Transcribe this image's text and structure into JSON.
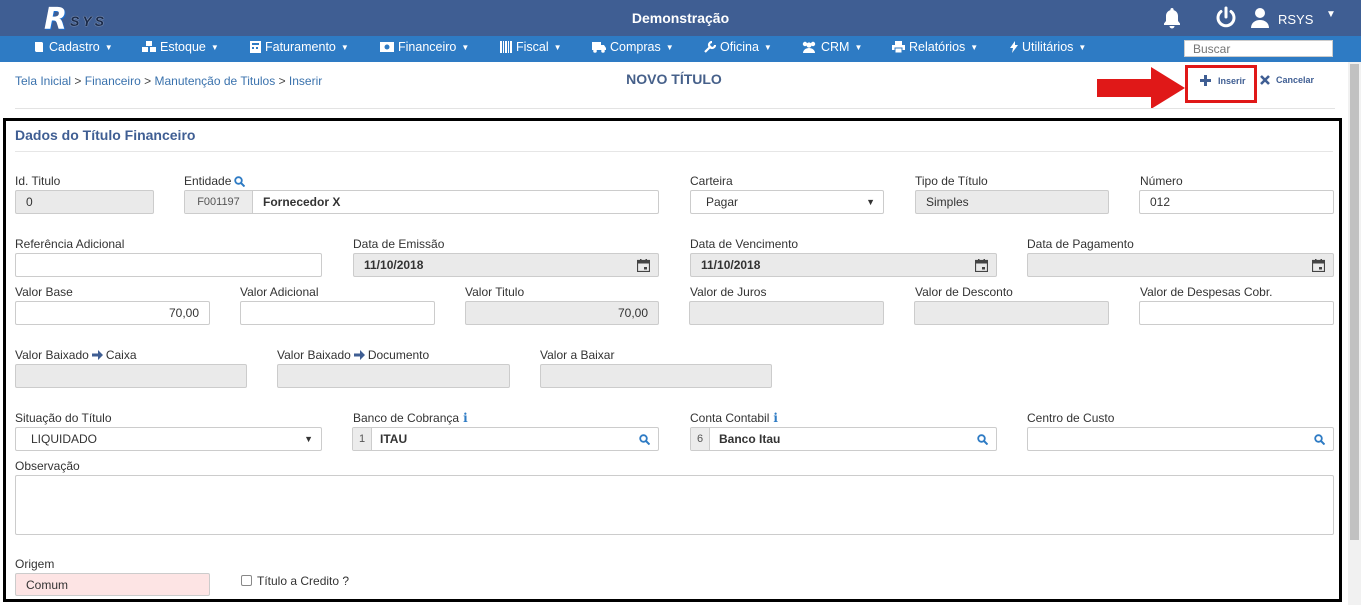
{
  "header": {
    "logo_text_r": "R",
    "logo_text_sys": "SYS",
    "title": "Demonstração",
    "user": "RSYS"
  },
  "nav": {
    "items": [
      {
        "label": "Cadastro",
        "icon": "book-icon"
      },
      {
        "label": "Estoque",
        "icon": "cubes-icon"
      },
      {
        "label": "Faturamento",
        "icon": "calculator-icon"
      },
      {
        "label": "Financeiro",
        "icon": "money-icon"
      },
      {
        "label": "Fiscal",
        "icon": "barcode-icon"
      },
      {
        "label": "Compras",
        "icon": "truck-icon"
      },
      {
        "label": "Oficina",
        "icon": "wrench-icon"
      },
      {
        "label": "CRM",
        "icon": "users-icon"
      },
      {
        "label": "Relatórios",
        "icon": "print-icon"
      },
      {
        "label": "Utilitários",
        "icon": "bolt-icon"
      }
    ],
    "search_placeholder": "Buscar"
  },
  "breadcrumb": {
    "home": "Tela Inicial",
    "sep": ">",
    "financeiro": "Financeiro",
    "manutencao": "Manutenção de Titulos",
    "inserir": "Inserir"
  },
  "page_title": "NOVO TÍTULO",
  "actions": {
    "insert": "Inserir",
    "cancel": "Cancelar"
  },
  "form": {
    "section_title": "Dados do Título Financeiro",
    "id_titulo": {
      "label": "Id. Titulo",
      "value": "0"
    },
    "entidade": {
      "label": "Entidade",
      "code": "F001197",
      "value": "Fornecedor X"
    },
    "carteira": {
      "label": "Carteira",
      "value": "Pagar"
    },
    "tipo_titulo": {
      "label": "Tipo de Título",
      "value": "Simples"
    },
    "numero": {
      "label": "Número",
      "value": "012"
    },
    "referencia": {
      "label": "Referência Adicional",
      "value": ""
    },
    "data_emissao": {
      "label": "Data de Emissão",
      "value": "11/10/2018"
    },
    "data_vencimento": {
      "label": "Data de Vencimento",
      "value": "11/10/2018"
    },
    "data_pagamento": {
      "label": "Data de Pagamento",
      "value": ""
    },
    "valor_base": {
      "label": "Valor Base",
      "value": "70,00"
    },
    "valor_adicional": {
      "label": "Valor Adicional",
      "value": ""
    },
    "valor_titulo": {
      "label": "Valor Titulo",
      "value": "70,00"
    },
    "valor_juros": {
      "label": "Valor de Juros",
      "value": ""
    },
    "valor_desconto": {
      "label": "Valor de Desconto",
      "value": ""
    },
    "valor_despesas": {
      "label": "Valor de Despesas Cobr.",
      "value": ""
    },
    "baixado_caixa": {
      "label_a": "Valor Baixado",
      "label_b": "Caixa",
      "value": ""
    },
    "baixado_documento": {
      "label_a": "Valor Baixado",
      "label_b": "Documento",
      "value": ""
    },
    "valor_a_baixar": {
      "label": "Valor a Baixar",
      "value": ""
    },
    "situacao": {
      "label": "Situação do Título",
      "value": "LIQUIDADO"
    },
    "banco_cobranca": {
      "label": "Banco de Cobrança",
      "code": "1",
      "value": "ITAU"
    },
    "conta_contabil": {
      "label": "Conta Contabil",
      "code": "6",
      "value": "Banco Itau"
    },
    "centro_custo": {
      "label": "Centro de Custo",
      "value": ""
    },
    "observacao": {
      "label": "Observação",
      "value": ""
    },
    "origem": {
      "label": "Origem",
      "value": "Comum"
    },
    "titulo_credito": {
      "label": "Título a Credito ?"
    }
  },
  "colors": {
    "header": "#3f5e93",
    "nav": "#2e7bc4",
    "highlight": "#e01818"
  }
}
